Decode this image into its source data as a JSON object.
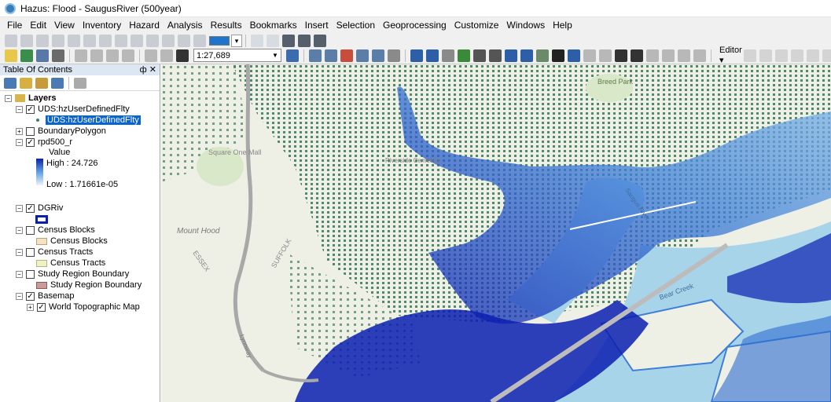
{
  "window": {
    "title": "Hazus: Flood - SaugusRiver (500year)"
  },
  "menu": [
    "File",
    "Edit",
    "View",
    "Inventory",
    "Hazard",
    "Analysis",
    "Results",
    "Bookmarks",
    "Insert",
    "Selection",
    "Geoprocessing",
    "Customize",
    "Windows",
    "Help"
  ],
  "toolbar": {
    "scale": "1:27,689",
    "editor_label": "Editor ▾"
  },
  "toc": {
    "title": "Table Of Contents",
    "pin_glyph": "ф ✕",
    "layers_label": "Layers",
    "items": [
      {
        "label": "UDS:hzUserDefinedFlty"
      },
      {
        "label": "UDS:hzUserDefinedFlty"
      },
      {
        "label": "BoundaryPolygon"
      },
      {
        "label": "rpd500_r"
      },
      {
        "label": "Value"
      },
      {
        "label": "High : 24.726"
      },
      {
        "label": "Low : 1.71661e-05"
      },
      {
        "label": "DGRiv"
      },
      {
        "label": "Census Blocks"
      },
      {
        "label": "Census Blocks"
      },
      {
        "label": "Census Tracts"
      },
      {
        "label": "Census Tracts"
      },
      {
        "label": "Study Region Boundary"
      },
      {
        "label": "Study Region Boundary"
      },
      {
        "label": "Basemap"
      },
      {
        "label": "World Topographic Map"
      }
    ]
  },
  "map": {
    "labels": [
      "Breed Park",
      "Square One Mall",
      "Mount Hood",
      "ESSEX",
      "SUFFOLK",
      "Bear Creek",
      "Riverside Cemetery",
      "Saugus River",
      "Lynnway"
    ],
    "colors": {
      "land": "#eef0e6",
      "water": "#a8d4ea",
      "buildings": "#3f7d62",
      "flood_high": "#0a1fb0",
      "flood_low": "#7fb5e8",
      "road": "#a8a8a8"
    }
  }
}
